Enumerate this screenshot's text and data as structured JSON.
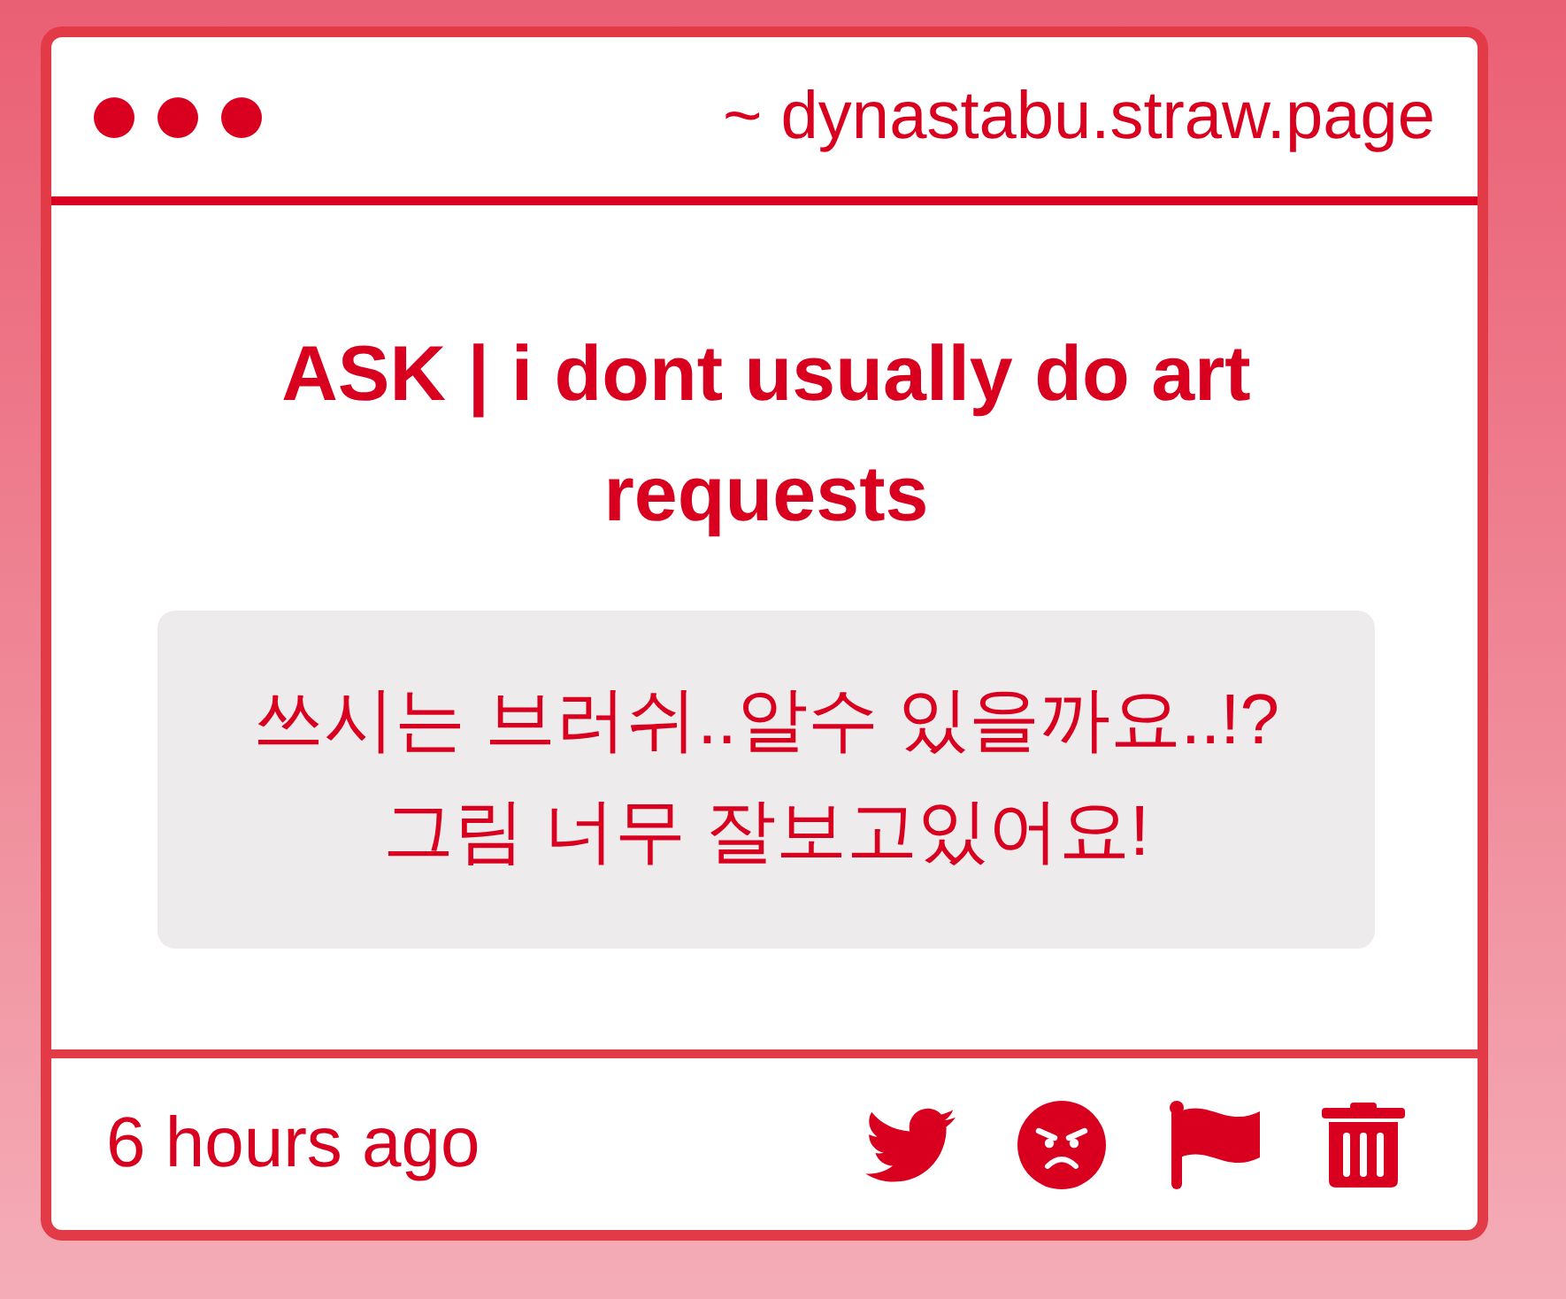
{
  "window": {
    "url": "~ dynastabu.straw.page"
  },
  "post": {
    "title": "ASK | i dont usually do art requests",
    "message": "쓰시는 브러쉬..알수 있을까요..!?\n그림 너무 잘보고있어요!"
  },
  "footer": {
    "time": "6 hours ago",
    "actions": [
      {
        "kind": "share"
      },
      {
        "kind": "react"
      },
      {
        "kind": "report"
      },
      {
        "kind": "delete"
      }
    ]
  }
}
